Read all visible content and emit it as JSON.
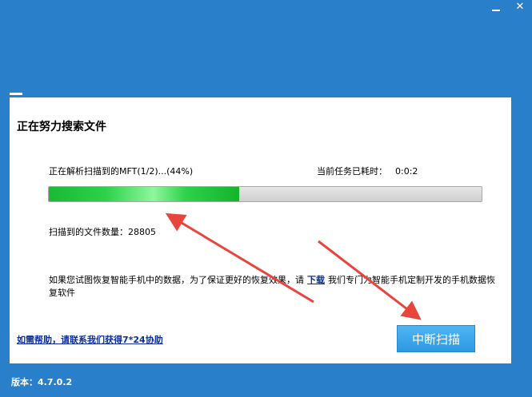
{
  "window": {
    "controls": {
      "close_glyph": "✕"
    }
  },
  "scan": {
    "title": "正在努力搜索文件",
    "status_text": "正在解析扫描到的MFT(1/2)...(44%)",
    "progress": 0.44,
    "elapsed_label": "当前任务已耗时：",
    "elapsed_value": "0:0:2",
    "count_label": "扫描到的文件数量：",
    "count_value": "28805",
    "notice_before": "如果您试图恢复智能手机中的数据，为了保证更好的恢复效果，请",
    "notice_link": "下载",
    "notice_after": "我们专门为智能手机定制开发的手机数据恢复软件",
    "help_link": "如需帮助，请联系我们获得7*24协助",
    "stop_button": "中断扫描"
  },
  "footer": {
    "version": "版本：4.7.0.2"
  },
  "colors": {
    "window_bg": "#2a7fca",
    "panel_bg": "#ffffff",
    "progress_fill": "#2cd24a",
    "button_bg": "#3aa6ec",
    "link": "#0b2f9c",
    "annotation_arrow": "#e8453c"
  },
  "icons": [
    "minimize-icon",
    "close-icon",
    "red-arrow-annotation"
  ]
}
